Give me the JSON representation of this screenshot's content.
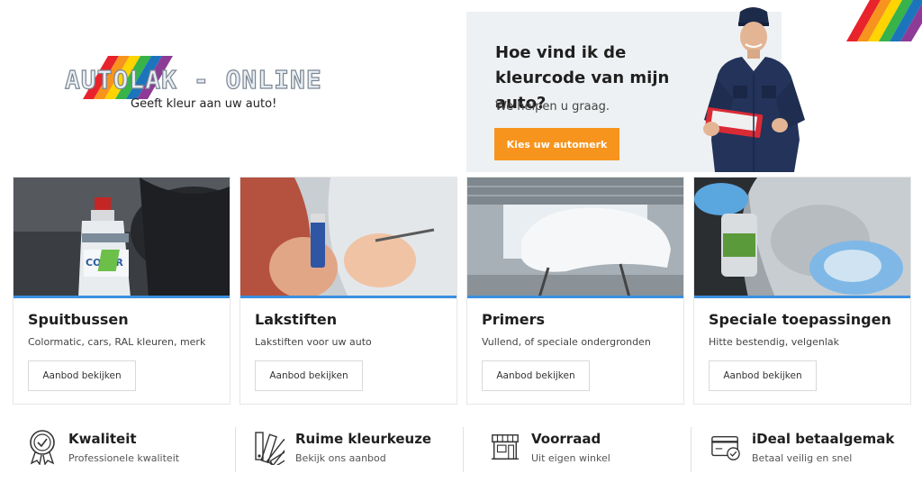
{
  "logo": {
    "text": "AUTOLAK - ONLINE",
    "tagline": "Geeft kleur aan uw auto!"
  },
  "colors": {
    "accent_orange": "#f7941d",
    "accent_blue": "#3a8fe0",
    "hero_bg": "#eef1f3",
    "rainbow": [
      "#e8232c",
      "#f7941d",
      "#ffd400",
      "#37b34a",
      "#1c75bc",
      "#8e3b97"
    ]
  },
  "hero": {
    "title": "Hoe vind ik de kleurcode van mijn auto?",
    "subtitle": "We helpen u graag.",
    "button_label": "Kies uw automerk"
  },
  "cards": [
    {
      "title": "Spuitbussen",
      "description": "Colormatic, cars, RAL kleuren, merk",
      "button_label": "Aanbod bekijken"
    },
    {
      "title": "Lakstiften",
      "description": "Lakstiften voor uw auto",
      "button_label": "Aanbod bekijken"
    },
    {
      "title": "Primers",
      "description": "Vullend, of speciale ondergronden",
      "button_label": "Aanbod bekijken"
    },
    {
      "title": "Speciale toepassingen",
      "description": "Hitte bestendig, velgenlak",
      "button_label": "Aanbod bekijken"
    }
  ],
  "features": [
    {
      "title": "Kwaliteit",
      "subtitle": "Professionele kwaliteit",
      "icon": "award-ribbon-icon"
    },
    {
      "title": "Ruime kleurkeuze",
      "subtitle": "Bekijk ons aanbod",
      "icon": "color-fan-icon"
    },
    {
      "title": "Voorraad",
      "subtitle": "Uit eigen winkel",
      "icon": "storefront-icon"
    },
    {
      "title": "iDeal betaalgemak",
      "subtitle": "Betaal veilig en snel",
      "icon": "credit-card-check-icon"
    }
  ]
}
